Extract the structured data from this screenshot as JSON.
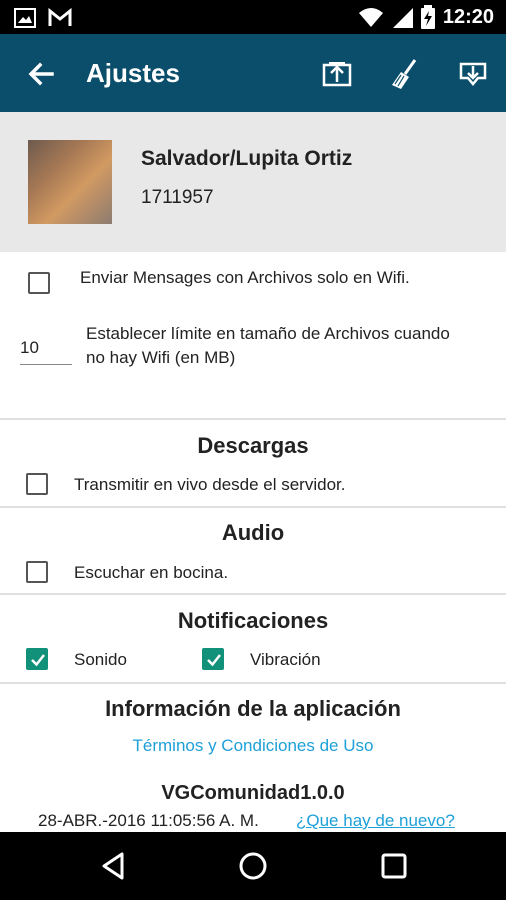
{
  "statusbar": {
    "time": "12:20"
  },
  "appbar": {
    "title": "Ajustes"
  },
  "profile": {
    "name": "Salvador/Lupita Ortiz",
    "phone": "1711957"
  },
  "settings": {
    "wifi_only_label": "Enviar Mensages con Archivos solo en Wifi.",
    "wifi_only_checked": false,
    "limit_value": "10",
    "limit_label_line1": "Establecer límite en tamaño de Archivos cuando",
    "limit_label_line2": "no hay Wifi (en MB)"
  },
  "descargas": {
    "title": "Descargas",
    "stream_label": "Transmitir en vivo desde el servidor.",
    "stream_checked": false
  },
  "audio": {
    "title": "Audio",
    "speaker_label": "Escuchar en bocina.",
    "speaker_checked": false
  },
  "notificaciones": {
    "title": "Notificaciones",
    "sound_label": "Sonido",
    "sound_checked": true,
    "vibration_label": "Vibración",
    "vibration_checked": true
  },
  "app_info": {
    "title": "Información de la aplicación",
    "terms_link": "Términos y Condiciones de Uso",
    "version": "VGComunidad1.0.0",
    "build_date": "28-ABR.-2016 11:05:56 A. M.",
    "whats_new_link": "¿Que hay de nuevo?"
  },
  "colors": {
    "appbar": "#0a4e6b",
    "accent": "#11907a",
    "link": "#1ea0d8"
  }
}
